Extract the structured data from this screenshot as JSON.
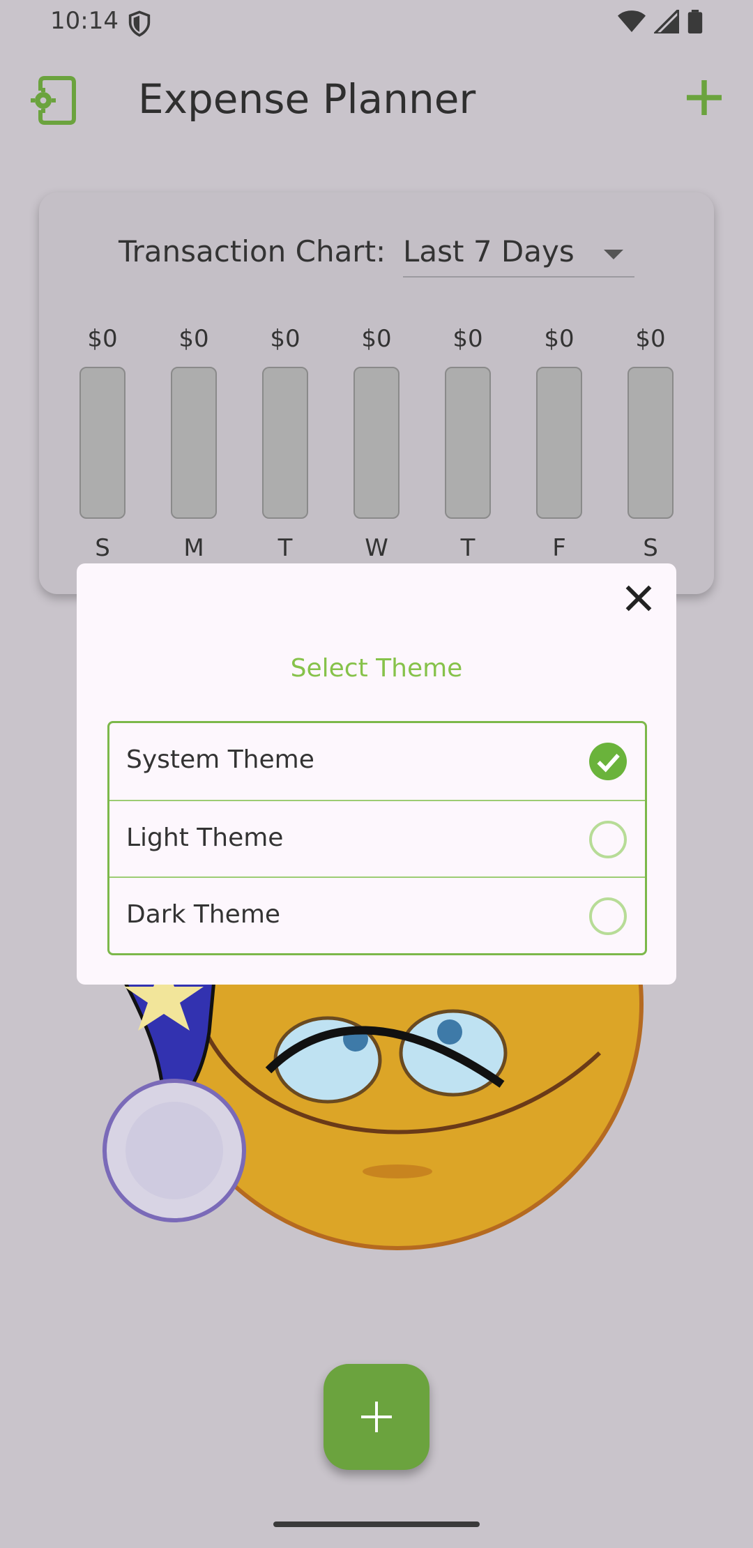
{
  "status_bar": {
    "time": "10:14"
  },
  "app_bar": {
    "title": "Expense Planner"
  },
  "chart": {
    "label": "Transaction Chart:",
    "period": "Last 7 Days",
    "bars": [
      {
        "day": "S",
        "amount": "$0"
      },
      {
        "day": "M",
        "amount": "$0"
      },
      {
        "day": "T",
        "amount": "$0"
      },
      {
        "day": "W",
        "amount": "$0"
      },
      {
        "day": "T",
        "amount": "$0"
      },
      {
        "day": "F",
        "amount": "$0"
      },
      {
        "day": "S",
        "amount": "$0"
      }
    ]
  },
  "dialog": {
    "title": "Select Theme",
    "options": [
      {
        "label": "System Theme",
        "selected": true
      },
      {
        "label": "Light Theme",
        "selected": false
      },
      {
        "label": "Dark Theme",
        "selected": false
      }
    ]
  },
  "colors": {
    "accent": "#6ba33e",
    "title_green": "#86c24a"
  },
  "icons": {
    "settings": "phone-settings-icon",
    "add": "plus-icon",
    "close": "close-icon",
    "check": "check-icon"
  }
}
